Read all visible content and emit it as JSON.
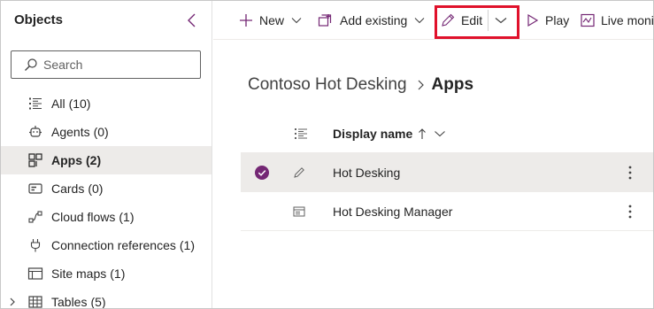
{
  "sidebar": {
    "title": "Objects",
    "search_placeholder": "Search",
    "items": [
      {
        "label": "All",
        "count": "(10)",
        "icon": "list-icon"
      },
      {
        "label": "Agents",
        "count": "(0)",
        "icon": "agent-icon"
      },
      {
        "label": "Apps",
        "count": "(2)",
        "icon": "apps-icon",
        "active": true
      },
      {
        "label": "Cards",
        "count": "(0)",
        "icon": "card-icon"
      },
      {
        "label": "Cloud flows",
        "count": "(1)",
        "icon": "flow-icon"
      },
      {
        "label": "Connection references",
        "count": "(1)",
        "icon": "plug-icon"
      },
      {
        "label": "Site maps",
        "count": "(1)",
        "icon": "sitemap-icon"
      },
      {
        "label": "Tables",
        "count": "(5)",
        "icon": "table-icon",
        "expandable": true
      }
    ]
  },
  "toolbar": {
    "new_label": "New",
    "add_existing_label": "Add existing",
    "edit_label": "Edit",
    "play_label": "Play",
    "live_monitor_label": "Live moni"
  },
  "breadcrumb": {
    "parent": "Contoso Hot Desking",
    "current": "Apps"
  },
  "grid": {
    "column_header": "Display name",
    "sort": "ascending",
    "rows": [
      {
        "name": "Hot Desking",
        "selected": true,
        "icon": "pencil-icon"
      },
      {
        "name": "Hot Desking Manager",
        "selected": false,
        "icon": "form-icon"
      }
    ]
  },
  "colors": {
    "accent": "#742774",
    "highlight_border": "#e0112b",
    "selected_row": "#edebe9"
  }
}
